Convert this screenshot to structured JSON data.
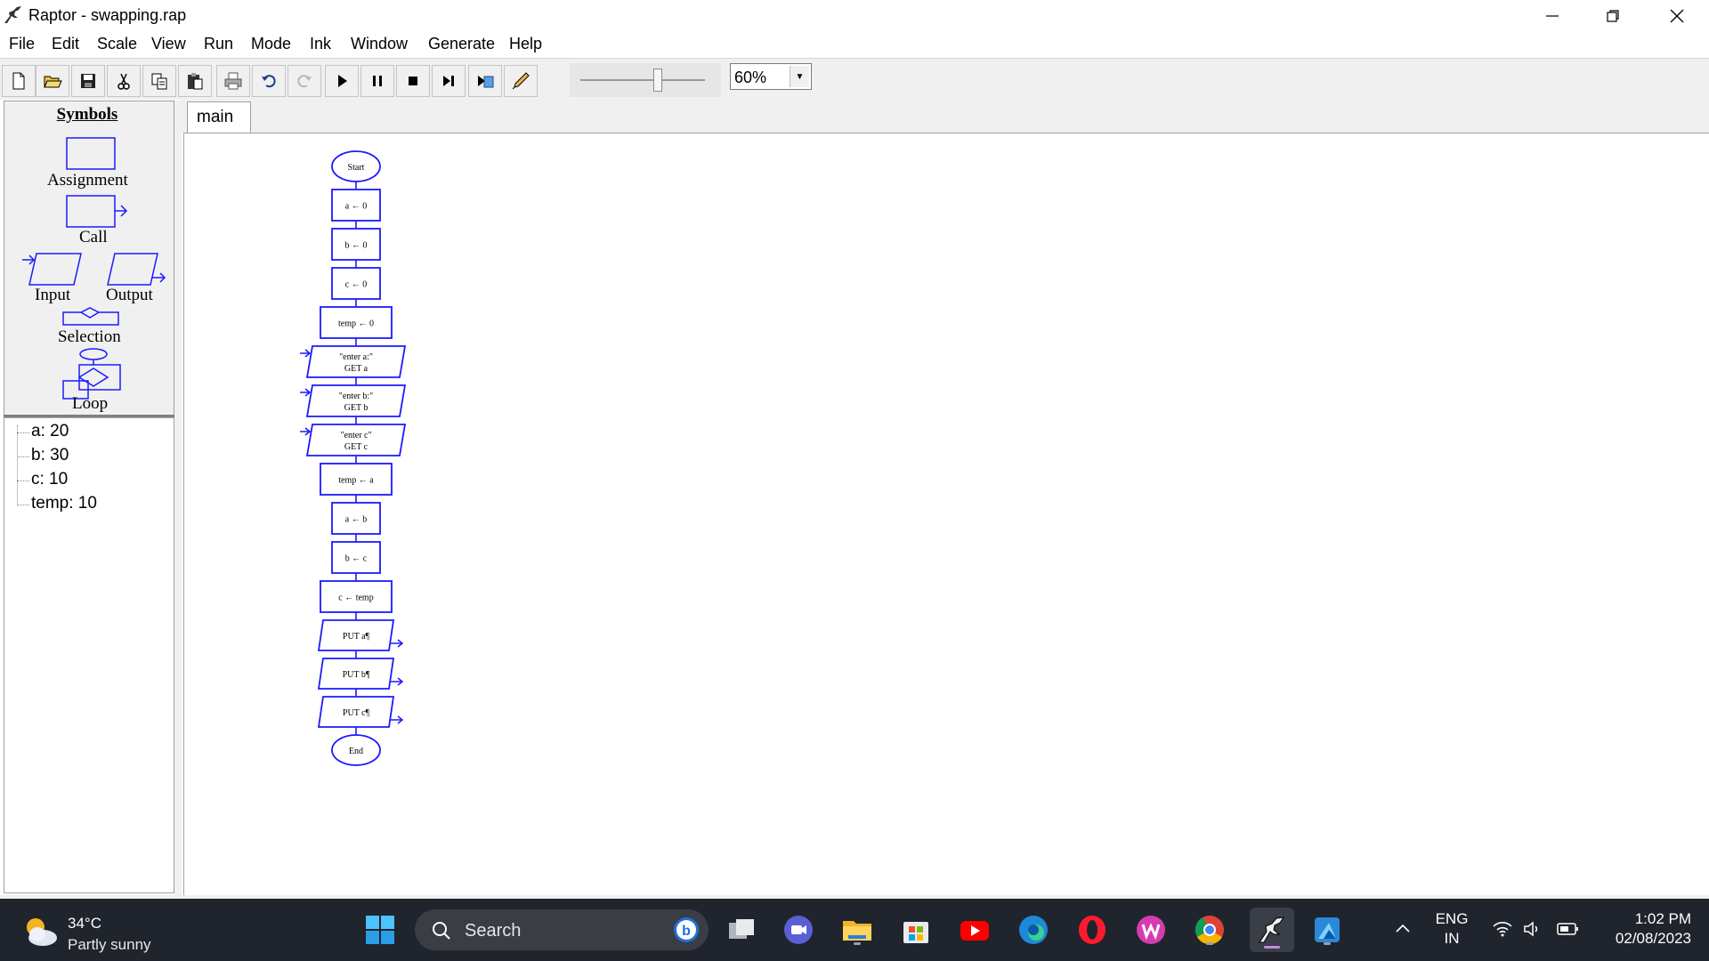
{
  "window": {
    "title": "Raptor - swapping.rap",
    "icon": "raptor-icon",
    "controls": [
      "minimize-icon",
      "restore-icon",
      "close-icon"
    ]
  },
  "menu": [
    "File",
    "Edit",
    "Scale",
    "View",
    "Run",
    "Mode",
    "Ink",
    "Window",
    "Generate",
    "Help"
  ],
  "toolbar": {
    "buttons": [
      "new-file-icon",
      "open-folder-icon",
      "save-icon",
      "cut-icon",
      "copy-icon",
      "paste-icon",
      "print-icon",
      "undo-icon",
      "redo-icon",
      "play-icon",
      "pause-icon",
      "stop-icon",
      "step-icon",
      "step-into-icon",
      "pen-icon"
    ],
    "speed_level": 0.62,
    "zoom": "60%"
  },
  "symbols_panel": {
    "heading": "Symbols",
    "labels": {
      "assignment": "Assignment",
      "call": "Call",
      "input": "Input",
      "output": "Output",
      "selection": "Selection",
      "loop": "Loop"
    }
  },
  "variables": [
    {
      "name": "a",
      "value": "20",
      "text": "a: 20"
    },
    {
      "name": "b",
      "value": "30",
      "text": "b: 30"
    },
    {
      "name": "c",
      "value": "10",
      "text": "c: 10"
    },
    {
      "name": "temp",
      "value": "10",
      "text": "temp: 10"
    }
  ],
  "tabs": [
    "main"
  ],
  "flowchart": {
    "accent_color": "#1a1aff",
    "nodes": [
      {
        "type": "terminal",
        "lines": [
          "Start"
        ]
      },
      {
        "type": "assignment",
        "lines": [
          "a ← 0"
        ]
      },
      {
        "type": "assignment",
        "lines": [
          "b ← 0"
        ]
      },
      {
        "type": "assignment",
        "lines": [
          "c ← 0"
        ]
      },
      {
        "type": "assignment",
        "lines": [
          "temp ← 0"
        ]
      },
      {
        "type": "input",
        "lines": [
          "\"enter a:\"",
          "GET a"
        ]
      },
      {
        "type": "input",
        "lines": [
          "\"enter b:\"",
          "GET b"
        ]
      },
      {
        "type": "input",
        "lines": [
          "\"enter c\"",
          "GET c"
        ]
      },
      {
        "type": "assignment",
        "lines": [
          "temp ← a"
        ]
      },
      {
        "type": "assignment",
        "lines": [
          "a ← b"
        ]
      },
      {
        "type": "assignment",
        "lines": [
          "b ← c"
        ]
      },
      {
        "type": "assignment",
        "lines": [
          "c ← temp"
        ]
      },
      {
        "type": "output",
        "lines": [
          "PUT a¶"
        ]
      },
      {
        "type": "output",
        "lines": [
          "PUT b¶"
        ]
      },
      {
        "type": "output",
        "lines": [
          "PUT c¶"
        ]
      },
      {
        "type": "terminal",
        "lines": [
          "End"
        ]
      }
    ]
  },
  "taskbar": {
    "weather": {
      "temp": "34°C",
      "condition": "Partly sunny"
    },
    "search_placeholder": "Search",
    "apps": [
      "windows-start-icon",
      "bing-icon",
      "task-view-icon",
      "meet-icon",
      "file-explorer-icon",
      "microsoft-store-icon",
      "youtube-icon",
      "edge-icon",
      "opera-icon",
      "wps-office-icon",
      "chrome-icon",
      "raptor-icon",
      "azure-data-studio-icon"
    ],
    "tray": {
      "language_line1": "ENG",
      "language_line2": "IN"
    },
    "clock": {
      "time": "1:02 PM",
      "date": "02/08/2023"
    }
  }
}
